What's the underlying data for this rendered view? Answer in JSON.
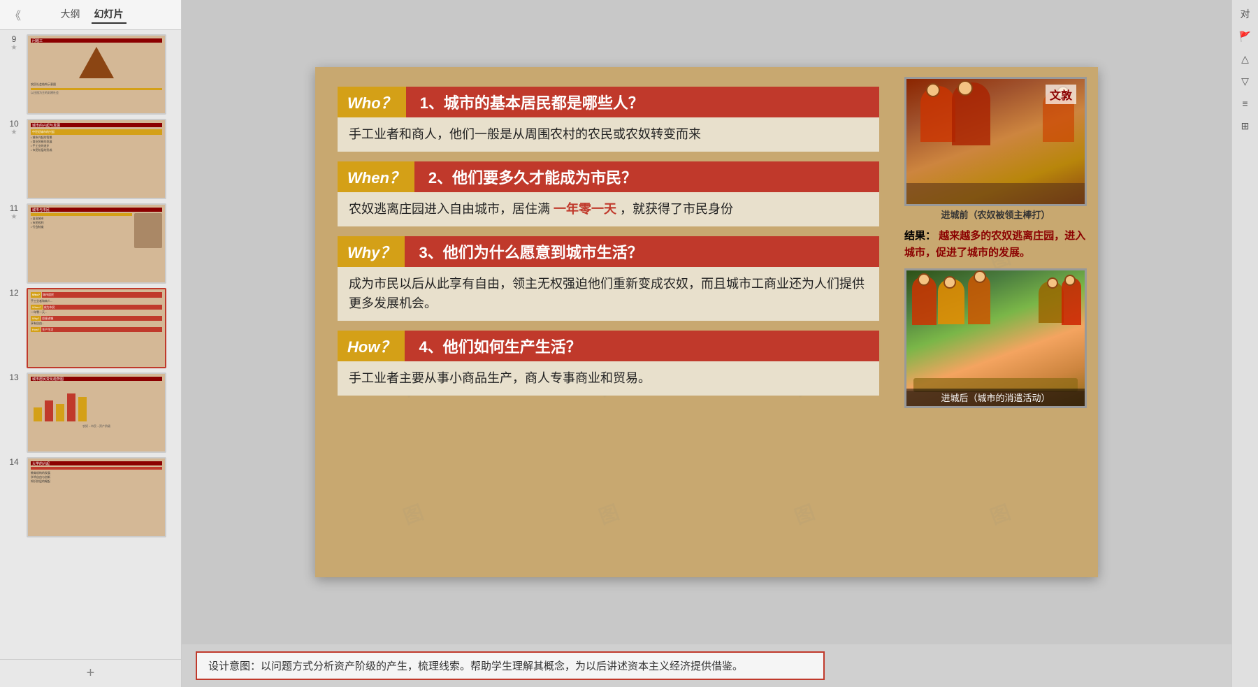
{
  "app": {
    "title": "大纲 幻灯片",
    "tabs": [
      "大纲",
      "幻灯片"
    ]
  },
  "sidebar": {
    "slides": [
      {
        "number": "9",
        "starred": true,
        "type": "pyramid"
      },
      {
        "number": "10",
        "starred": true,
        "type": "text"
      },
      {
        "number": "11",
        "starred": true,
        "type": "text-image"
      },
      {
        "number": "12",
        "starred": false,
        "type": "active",
        "active": true
      },
      {
        "number": "13",
        "starred": false,
        "type": "chart"
      },
      {
        "number": "14",
        "starred": false,
        "type": "text2"
      }
    ],
    "add_button": "+"
  },
  "slide": {
    "wendun_label": "文敦",
    "questions": [
      {
        "label": "Who？",
        "title": "1、城市的基本居民都是哪些人？",
        "answer": "手工业者和商人，他们一般是从周围农村的农民或农奴转变而来"
      },
      {
        "label": "When？",
        "title": "2、他们要多久才能成为市民？",
        "answer_parts": [
          "农奴逃离庄园进入自由城市，居住满",
          "一年零一天",
          "，就获得了市民身份"
        ],
        "highlight": "一年零一天"
      },
      {
        "label": "Why？",
        "title": "3、他们为什么愿意到城市生活？",
        "answer": "成为市民以后从此享有自由，领主无权强迫他们重新变成农奴，而且城市工商业还为人们提供更多发展机会。"
      },
      {
        "label": "How？",
        "title": "4、他们如何生产生活？",
        "answer": "手工业者主要从事小商品生产，商人专事商业和贸易。"
      }
    ],
    "right_panel": {
      "top_image_caption": "进城前（农奴被领主棒打）",
      "result_label": "结果：",
      "result_text": "越来越多的农奴逃离庄园，进入城市，促进了城市的发展。",
      "bottom_image_caption": "进城后（城市的消遣活动）"
    },
    "watermark_text": "图"
  },
  "annotation": {
    "text": "设计意图：以问题方式分析资产阶级的产生，梳理线索。帮助学生理解其概念，为以后讲述资本主义经济提供借鉴。"
  },
  "right_toolbar": {
    "buttons": [
      "对",
      "△",
      "▽",
      "≡",
      "⊞"
    ]
  }
}
